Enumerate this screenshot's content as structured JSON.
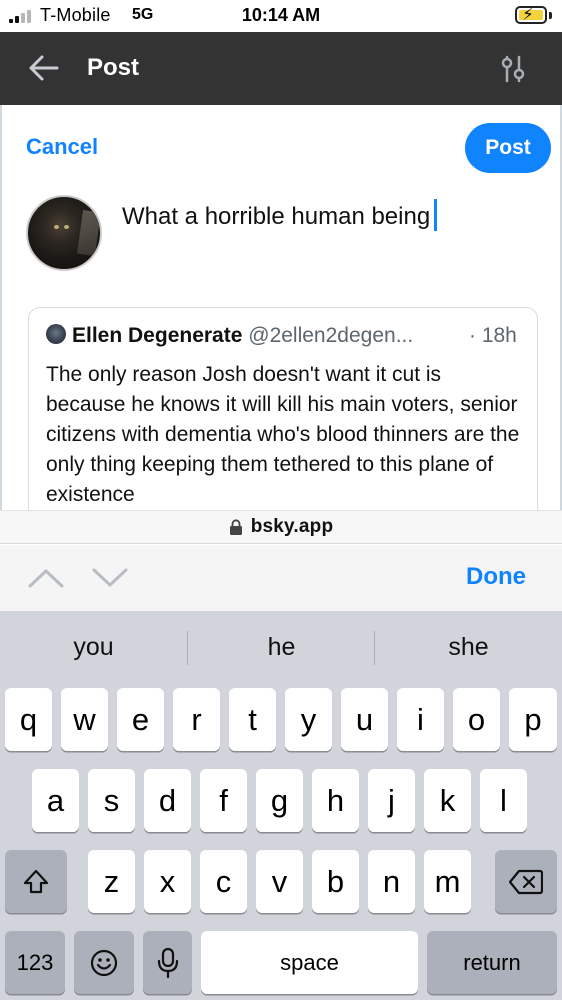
{
  "status_bar": {
    "carrier": "T-Mobile",
    "network": "5G",
    "time": "10:14 AM"
  },
  "header": {
    "title": "Post",
    "background": "#333333"
  },
  "composer": {
    "cancel_label": "Cancel",
    "post_label": "Post",
    "text": "What a horrible human being",
    "quote": {
      "author_name": "Ellen Degenerate",
      "author_handle": "@2ellen2degen...",
      "age": "· 18h",
      "body": "The only reason Josh doesn't want it cut is because he knows it will kill his main voters, senior citizens with dementia who's blood thinners are the only thing keeping them tethered to this plane of existence"
    }
  },
  "browser": {
    "url": "bsky.app"
  },
  "accessory": {
    "done_label": "Done"
  },
  "keyboard": {
    "suggestions": [
      "you",
      "he",
      "she"
    ],
    "row1": [
      "q",
      "w",
      "e",
      "r",
      "t",
      "y",
      "u",
      "i",
      "o",
      "p"
    ],
    "row2": [
      "a",
      "s",
      "d",
      "f",
      "g",
      "h",
      "j",
      "k",
      "l"
    ],
    "row3": [
      "z",
      "x",
      "c",
      "v",
      "b",
      "n",
      "m"
    ],
    "numbers_label": "123",
    "space_label": "space",
    "return_label": "return"
  },
  "colors": {
    "accent": "#1083fe",
    "header_bg": "#333333",
    "battery_fill": "#f2d33c",
    "keyboard_bg": "#d1d4da"
  },
  "icons": {
    "back": "arrow-left-icon",
    "filter": "sliders-icon",
    "lock": "lock-icon",
    "up": "chevron-up-icon",
    "down": "chevron-down-icon",
    "shift": "shift-icon",
    "delete": "backspace-icon",
    "emoji": "emoji-icon",
    "mic": "microphone-icon"
  }
}
